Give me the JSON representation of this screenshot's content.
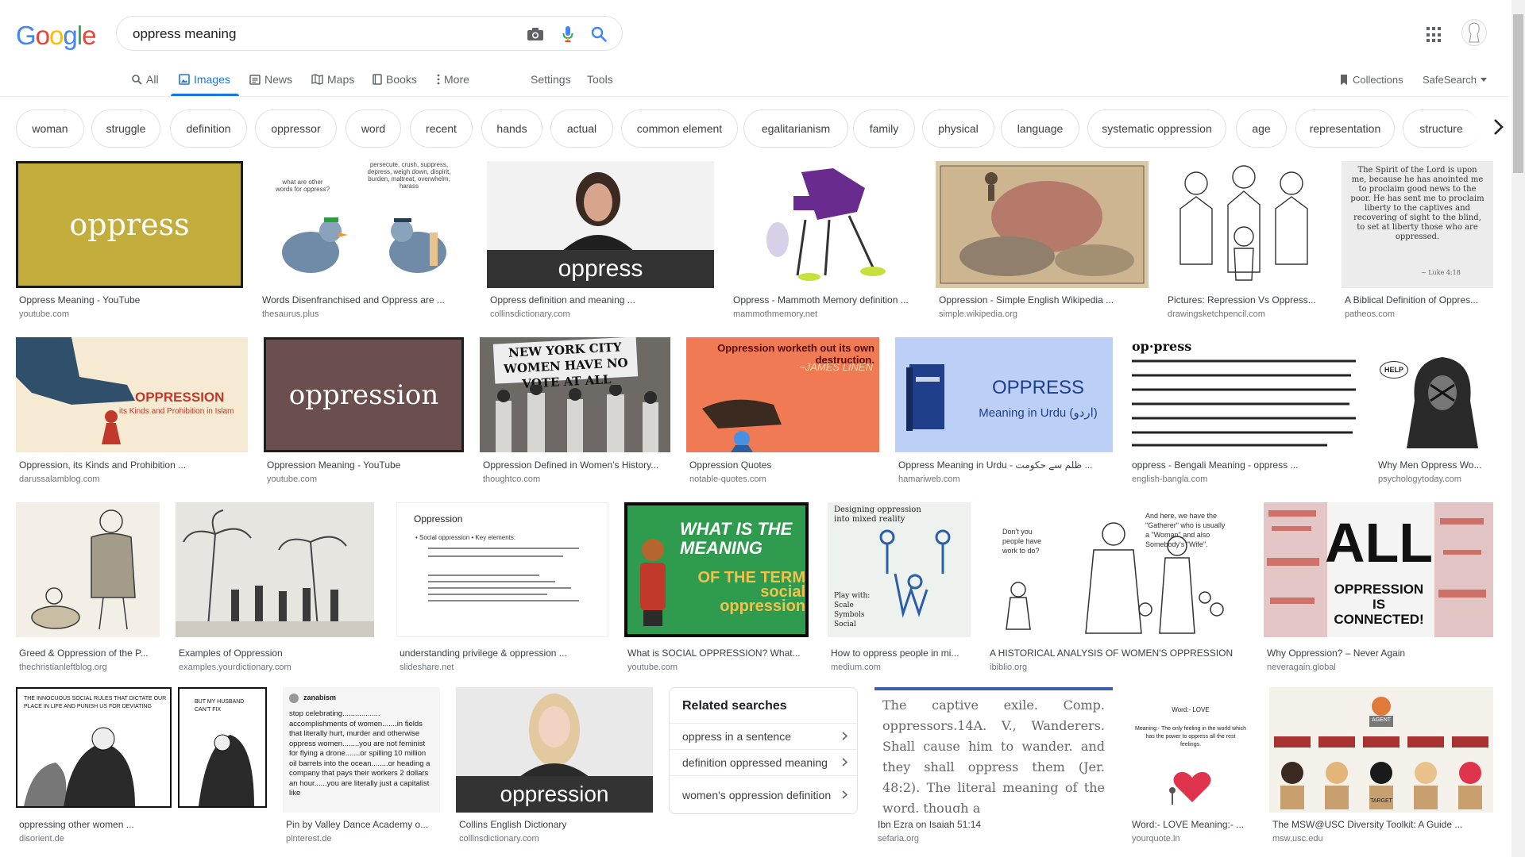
{
  "logo": {
    "letters": [
      "G",
      "o",
      "o",
      "g",
      "l",
      "e"
    ],
    "colors": [
      "#4285f4",
      "#ea4335",
      "#fbbc05",
      "#4285f4",
      "#34a853",
      "#ea4335"
    ]
  },
  "search": {
    "value": "oppress meaning"
  },
  "tabs": [
    {
      "label": "All",
      "icon": "search-icon"
    },
    {
      "label": "Images",
      "icon": "image-icon",
      "active": true
    },
    {
      "label": "News",
      "icon": "news-icon"
    },
    {
      "label": "Maps",
      "icon": "map-icon"
    },
    {
      "label": "Books",
      "icon": "book-icon"
    },
    {
      "label": "More",
      "icon": "kebab-icon"
    },
    {
      "label": "Settings"
    },
    {
      "label": "Tools"
    },
    {
      "label": "Collections",
      "icon": "bookmark-icon"
    },
    {
      "label": "SafeSearch",
      "icon": "caret-down-icon"
    }
  ],
  "chips": [
    "woman",
    "struggle",
    "definition",
    "oppressor",
    "word",
    "recent",
    "hands",
    "actual",
    "common element",
    "egalitarianism",
    "family",
    "physical",
    "language",
    "systematic oppression",
    "age",
    "representation",
    "structure"
  ],
  "results": [
    {
      "caption": "Oppress Meaning - YouTube",
      "source": "youtube.com",
      "overlay": "oppress"
    },
    {
      "caption": "Words Disenfranchised and Oppress are ...",
      "source": "thesaurus.plus",
      "overlay": "what are other words for oppress?",
      "overlay2": "persecute, crush, suppress, depress, weigh down, dispirit, burden, maltreat, overwhelm, harass"
    },
    {
      "caption": "Oppress definition and meaning ...",
      "source": "collinsdictionary.com",
      "overlay": "oppress"
    },
    {
      "caption": "Oppress - Mammoth Memory definition ...",
      "source": "mammothmemory.net"
    },
    {
      "caption": "Oppression - Simple English Wikipedia ...",
      "source": "simple.wikipedia.org"
    },
    {
      "caption": "Pictures: Repression Vs Oppress...",
      "source": "drawingsketchpencil.com"
    },
    {
      "caption": "A Biblical Definition of Oppres...",
      "source": "patheos.com",
      "overlay": "The Spirit of the Lord is upon me, because he has anointed me to proclaim good news to the poor. He has sent me to proclaim liberty to the captives and recovering of sight to the blind, to set at liberty those who are oppressed.",
      "overlay2": "~ Luke 4:18"
    },
    {
      "caption": "Oppression, its Kinds and Prohibition ...",
      "source": "darussalamblog.com",
      "overlay": "OPPRESSION",
      "overlay2": "its Kinds and Prohibition in Islam"
    },
    {
      "caption": "Oppression Meaning - YouTube",
      "source": "youtube.com",
      "overlay": "oppression"
    },
    {
      "caption": "Oppression Defined in Women's History...",
      "source": "thoughtco.com",
      "overlay": "NEW YORK CITY WOMEN HAVE NO VOTE AT ALL"
    },
    {
      "caption": "Oppression Quotes",
      "source": "notable-quotes.com",
      "overlay": "Oppression worketh out its own destruction.",
      "overlay2": "~JAMES LINEN"
    },
    {
      "caption": "Oppress Meaning in Urdu - ظلم سے حکومت ...",
      "source": "hamariweb.com",
      "overlay": "OPPRESS",
      "overlay2": "Meaning in Urdu (اردو)"
    },
    {
      "caption": "oppress - Bengali Meaning - oppress ...",
      "source": "english-bangla.com",
      "overlay": "op·press"
    },
    {
      "caption": "Why Men Oppress Wo...",
      "source": "psychologytoday.com",
      "overlay": "HELP"
    },
    {
      "caption": "Greed & Oppression of the P...",
      "source": "thechristianleftblog.org"
    },
    {
      "caption": "Examples of Oppression",
      "source": "examples.yourdictionary.com"
    },
    {
      "caption": "understanding privilege & oppression ...",
      "source": "slideshare.net",
      "overlay": "Oppression",
      "overlay2": "• Social oppression  • Key elements:"
    },
    {
      "caption": "What is SOCIAL OPPRESSION? What...",
      "source": "youtube.com",
      "overlay": "WHAT IS THE MEANING",
      "overlay2": "OF THE TERM social oppression"
    },
    {
      "caption": "How to oppress people in mi...",
      "source": "medium.com",
      "overlay": "Designing oppression into mixed reality",
      "overlay2": "Play with: Scale Symbols Social"
    },
    {
      "caption": "A HISTORICAL ANALYSIS OF WOMEN'S OPPRESSION",
      "source": "ibiblio.org"
    },
    {
      "caption": "Why Oppression? – Never Again",
      "source": "neveragain.global",
      "overlay": "ALL",
      "overlay2": "OPPRESSION IS CONNECTED!"
    },
    {
      "caption": "oppressing other women ...",
      "source": "disorient.de"
    },
    {
      "caption": "Pin by Valley Dance Academy o...",
      "source": "pinterest.de",
      "overlay": "zanabism",
      "overlay2": "stop celebrating.................. accomplishments of women.......in fields that literally hurt, murder and otherwise oppress women........you are not feminist for flying a drone.......or spilling 10 million oil barrels into the ocean........or heading a company that pays their workers 2 dollars an hour......you are literally just a capitalist like"
    },
    {
      "caption": "Collins English Dictionary",
      "source": "collinsdictionary.com",
      "overlay": "oppression"
    },
    {
      "caption": "Ibn Ezra on Isaiah 51:14",
      "source": "sefaria.org",
      "overlay": "The captive exile. Comp. oppressors.14A. V., Wanderers. Shall cause him to wander. and they shall oppress them (Jer. 48:2). The literal meaning of the word, though a"
    },
    {
      "caption": "Word:- LOVE Meaning:- ...",
      "source": "yourquote.in",
      "overlay": "Word:- LOVE",
      "overlay2": "Meaning:- The only feeling in the world which has the power to oppress all the rest feelings."
    },
    {
      "caption": "The MSW@USC Diversity Toolkit: A Guide ...",
      "source": "msw.usc.edu",
      "overlay": "AGENT",
      "overlay2": "TARGET"
    }
  ],
  "related": {
    "title": "Related searches",
    "items": [
      "oppress in a sentence",
      "definition oppressed meaning",
      "women's oppression definition"
    ]
  },
  "colors": {
    "accent": "#1a73e8",
    "link_gray": "#5f6368"
  }
}
